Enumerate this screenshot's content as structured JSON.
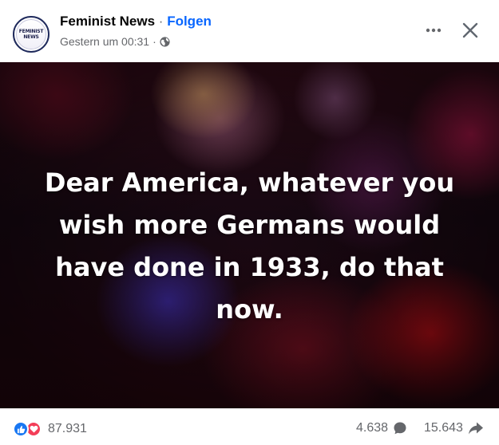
{
  "header": {
    "avatar_text": "FEMINIST NEWS",
    "page_name": "Feminist News",
    "separator": "·",
    "follow_label": "Folgen",
    "timestamp": "Gestern um 00:31",
    "meta_separator": "·",
    "audience_icon": "globe-icon",
    "more_icon": "more-horizontal-icon",
    "close_icon": "close-icon"
  },
  "post": {
    "quote_text": "Dear America, whatever you wish more Germans would have done in 1933, do that now."
  },
  "footer": {
    "reaction_icons": [
      "like-icon",
      "love-icon"
    ],
    "reaction_count": "87.931",
    "comment_count": "4.638",
    "comment_icon": "comment-icon",
    "share_count": "15.643",
    "share_icon": "share-icon"
  },
  "colors": {
    "brand_blue": "#0866ff",
    "like_blue": "#1877f2",
    "love_red": "#f33e58",
    "secondary_text": "#65676b"
  }
}
